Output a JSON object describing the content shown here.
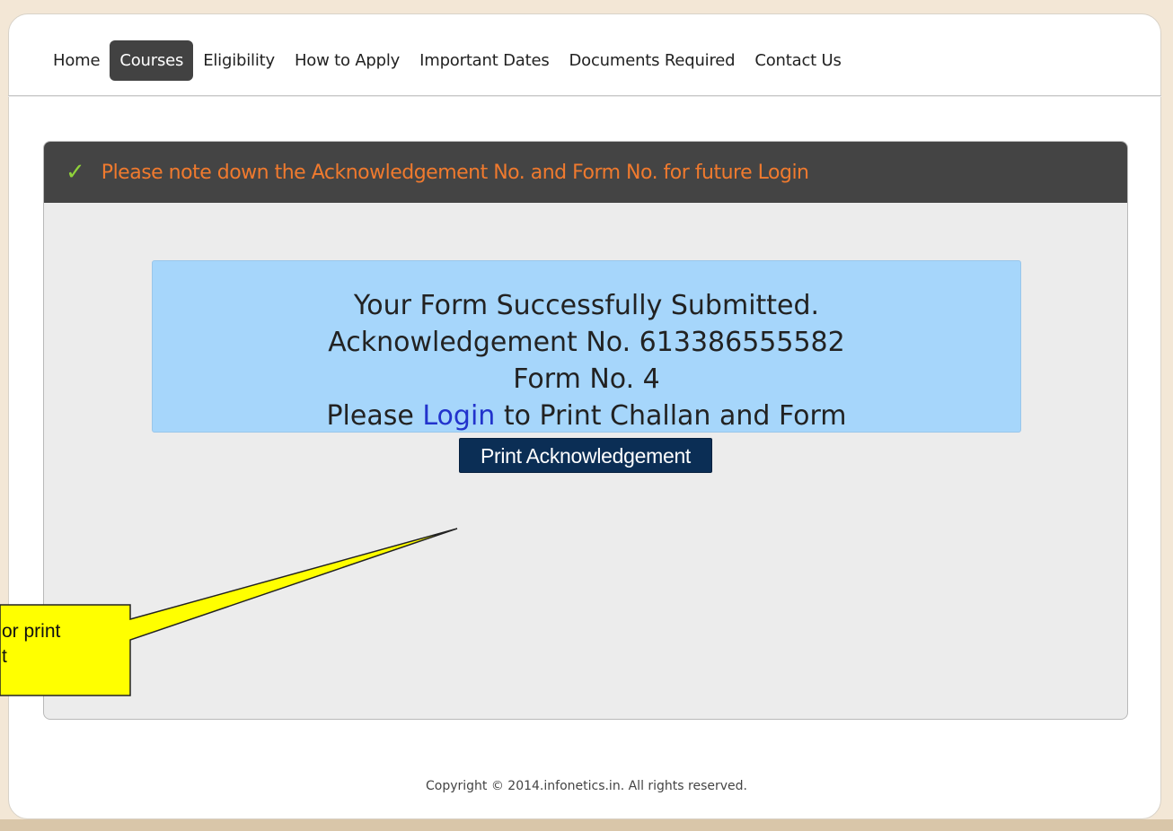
{
  "nav": {
    "items": [
      {
        "label": "Home",
        "active": false
      },
      {
        "label": "Courses",
        "active": true
      },
      {
        "label": "Eligibility",
        "active": false
      },
      {
        "label": "How to Apply",
        "active": false
      },
      {
        "label": "Important Dates",
        "active": false
      },
      {
        "label": "Documents Required",
        "active": false
      },
      {
        "label": "Contact Us",
        "active": false
      }
    ]
  },
  "panel": {
    "header_icon": "check-icon",
    "header_text": "Please note down the Acknowledgement No. and Form No. for future Login",
    "message": {
      "line1": "Your Form Successfully Submitted.",
      "line2": "Acknowledgement No. 613386555582",
      "line3": "Form No. 4",
      "line4_prefix": "Please ",
      "line4_link": "Login",
      "line4_suffix": " to Print Challan and Form"
    },
    "print_button_label": "Print Acknowledgement"
  },
  "callout": {
    "line1": "or print",
    "line2": "t"
  },
  "footer": {
    "copyright": "Copyright © 2014.infonetics.in. All rights reserved."
  },
  "colors": {
    "header_bg": "#444444",
    "header_text": "#f07a2e",
    "check": "#8fd23a",
    "message_bg": "#a6d6fb",
    "button_bg": "#0b2e55",
    "callout_bg": "#ffff00"
  }
}
